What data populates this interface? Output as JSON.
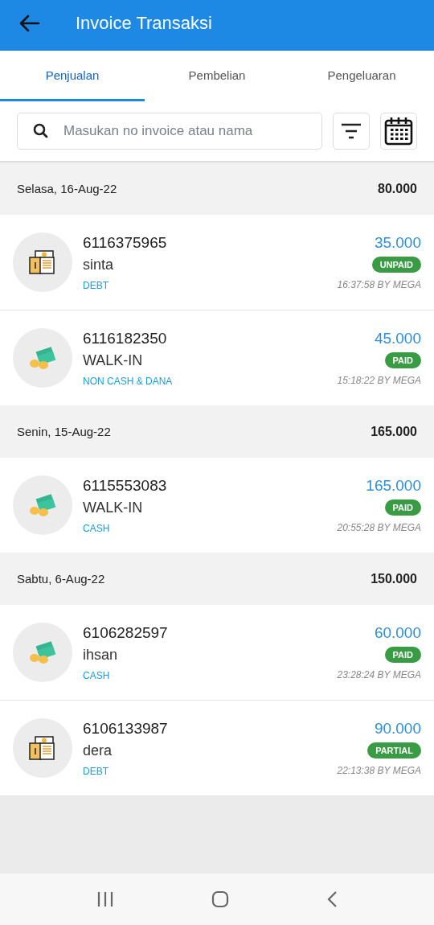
{
  "app_bar": {
    "title": "Invoice Transaksi"
  },
  "tabs": [
    {
      "label": "Penjualan",
      "selected": true
    },
    {
      "label": "Pembelian",
      "selected": false
    },
    {
      "label": "Pengeluaran",
      "selected": false
    }
  ],
  "search": {
    "placeholder": "Masukan no invoice atau nama"
  },
  "groups": [
    {
      "date": "Selasa, 16-Aug-22",
      "total": "80.000",
      "transactions": [
        {
          "kind": "debt",
          "number": "6116375965",
          "customer": "sinta",
          "method": "DEBT",
          "amount": "35.000",
          "status": "UNPAID",
          "time": "16:37:58 BY MEGA"
        },
        {
          "kind": "cash",
          "number": "6116182350",
          "customer": "WALK-IN",
          "method": "NON CASH & DANA",
          "amount": "45.000",
          "status": "PAID",
          "time": "15:18:22 BY MEGA"
        }
      ]
    },
    {
      "date": "Senin, 15-Aug-22",
      "total": "165.000",
      "transactions": [
        {
          "kind": "cash",
          "number": "6115553083",
          "customer": "WALK-IN",
          "method": "CASH",
          "amount": "165.000",
          "status": "PAID",
          "time": "20:55:28 BY MEGA"
        }
      ]
    },
    {
      "date": "Sabtu, 6-Aug-22",
      "total": "150.000",
      "transactions": [
        {
          "kind": "cash",
          "number": "6106282597",
          "customer": "ihsan",
          "method": "CASH",
          "amount": "60.000",
          "status": "PAID",
          "time": "23:28:24 BY MEGA"
        },
        {
          "kind": "debt",
          "number": "6106133987",
          "customer": "dera",
          "method": "DEBT",
          "amount": "90.000",
          "status": "PARTIAL",
          "time": "22:13:38 BY MEGA"
        }
      ]
    }
  ]
}
